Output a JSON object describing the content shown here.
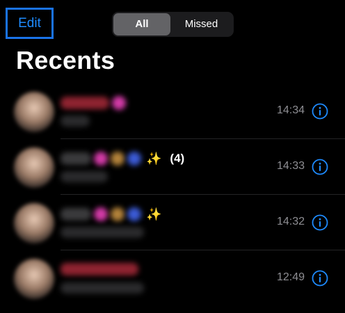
{
  "header": {
    "edit_label": "Edit",
    "segments": [
      "All",
      "Missed"
    ],
    "selected_segment": "All"
  },
  "page_title": "Recents",
  "calls": [
    {
      "time": "14:34",
      "name_color": "#a02a34",
      "count": "",
      "sparkle": false,
      "badges": [
        "#d23aa6"
      ]
    },
    {
      "time": "14:33",
      "name_color": "#3a3a3c",
      "count": "(4)",
      "sparkle": true,
      "badges": [
        "#d23aa6",
        "#b3823a",
        "#3b5bd6"
      ]
    },
    {
      "time": "14:32",
      "name_color": "#3a3a3c",
      "count": "",
      "sparkle": true,
      "badges": [
        "#d23aa6",
        "#b3823a",
        "#3b5bd6"
      ]
    },
    {
      "time": "12:49",
      "name_color": "#a02a34",
      "count": "",
      "sparkle": false,
      "badges": []
    }
  ],
  "icons": {
    "info": "info-circle-icon",
    "sparkle": "sparkles-emoji"
  },
  "colors": {
    "accent": "#1e8bff",
    "missed_red": "#a02a34",
    "time_gray": "#8e8e93"
  }
}
